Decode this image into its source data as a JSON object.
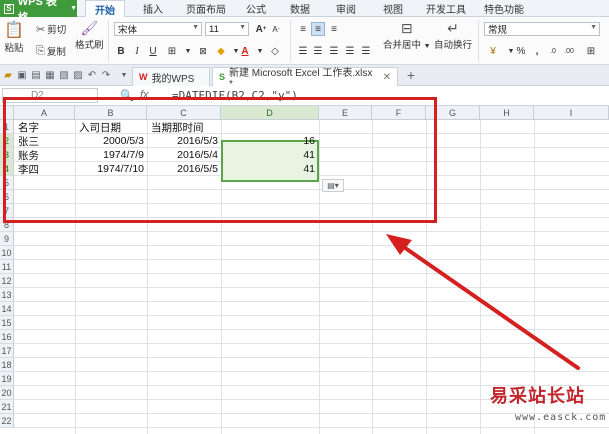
{
  "app": {
    "name": "WPS 表格"
  },
  "menu": {
    "tabs": [
      {
        "label": "开始",
        "active": true
      },
      {
        "label": "插入"
      },
      {
        "label": "页面布局"
      },
      {
        "label": "公式"
      },
      {
        "label": "数据"
      },
      {
        "label": "审阅"
      },
      {
        "label": "视图"
      },
      {
        "label": "开发工具"
      },
      {
        "label": "特色功能"
      }
    ]
  },
  "ribbon": {
    "paste_label": "粘贴",
    "cut_label": "剪切",
    "copy_label": "复制",
    "format_painter_label": "格式刷",
    "font_name": "宋体",
    "font_size": "11",
    "merge_center_label": "合并居中",
    "wrap_text_label": "自动换行",
    "number_format": "常规",
    "grow_font": "A",
    "shrink_font": "A",
    "bold": "B",
    "italic": "I",
    "underline": "U"
  },
  "tabs": {
    "home_tab": "我的WPS",
    "document_tab": "新建 Microsoft Excel 工作表.xlsx *",
    "new_tab_symbol": "+"
  },
  "formula_bar": {
    "name_box": "D2",
    "fx_label": "fx",
    "formula": "=DATEDIF(B2,C2,\"y\")"
  },
  "sheet": {
    "columns": [
      "A",
      "B",
      "C",
      "D",
      "E",
      "F",
      "G",
      "H",
      "I"
    ],
    "rows": [
      "1",
      "2",
      "3",
      "4",
      "5",
      "6",
      "7",
      "8",
      "9",
      "10",
      "11",
      "12",
      "13",
      "14",
      "15",
      "16",
      "17",
      "18",
      "19",
      "20",
      "21",
      "22"
    ],
    "selected_column": "D",
    "headers": {
      "A1": "名字",
      "B1": "入司日期",
      "C1": "当期那时间"
    },
    "data": [
      {
        "name": "张三",
        "hire_date": "2000/5/3",
        "current_date": "2016/5/3",
        "years": "16"
      },
      {
        "name": "账务",
        "hire_date": "1974/7/9",
        "current_date": "2016/5/4",
        "years": "41"
      },
      {
        "name": "李四",
        "hire_date": "1974/7/10",
        "current_date": "2016/5/5",
        "years": "41"
      }
    ]
  },
  "colors": {
    "brand_green": "#3f9a3b",
    "annotation_red": "#d61f1f",
    "selection_green": "#5aa54a"
  },
  "watermark": {
    "text": "易采站长站",
    "url": "www.easck.com"
  }
}
